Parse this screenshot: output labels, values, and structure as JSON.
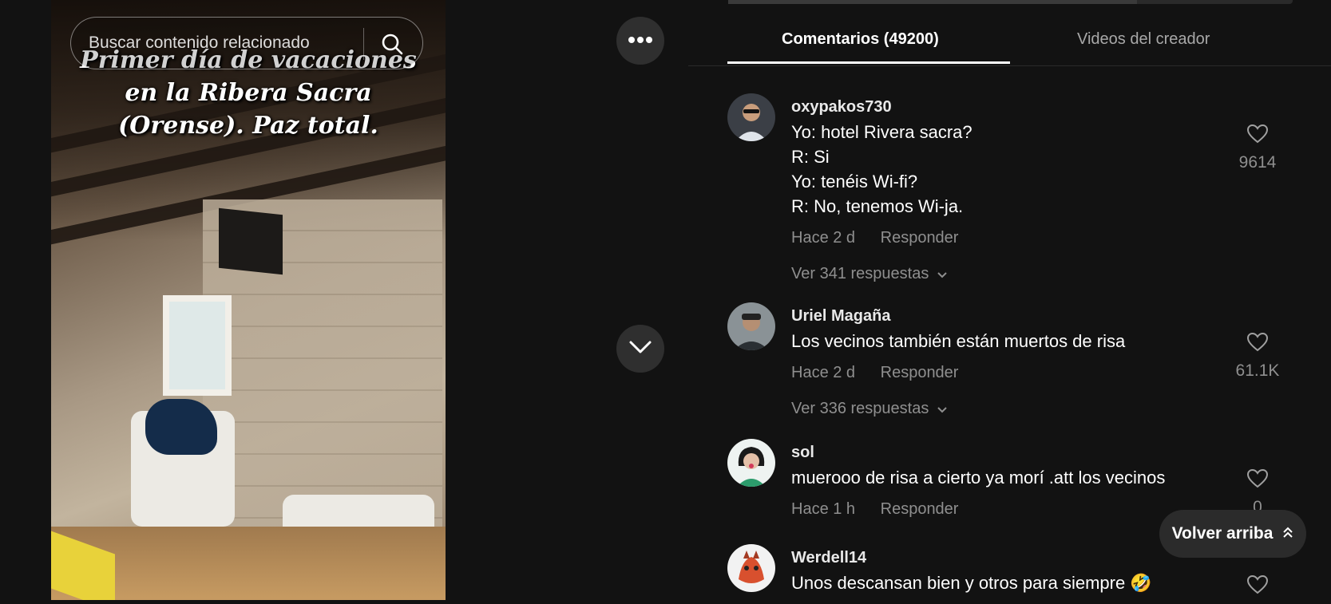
{
  "video": {
    "caption_lines": [
      "Primer día de vacaciones",
      "en la Ribera Sacra",
      "(Orense). Paz total."
    ],
    "search_placeholder": "Buscar contenido relacionado",
    "more_icon": "more-dots-icon",
    "next_icon": "chevron-down-icon"
  },
  "tabs": {
    "comments": "Comentarios (49200)",
    "creator_videos": "Videos del creador"
  },
  "comments": [
    {
      "username": "oxypakos730",
      "lines": [
        "Yo: hotel Rivera sacra?",
        "R: Si",
        "Yo: tenéis Wi-fi?",
        "R: No, tenemos Wi-ja."
      ],
      "time": "Hace 2 d",
      "reply_label": "Responder",
      "replies_label": "Ver 341 respuestas",
      "likes": "9614"
    },
    {
      "username": "Uriel Magaña",
      "lines": [
        "Los vecinos también están muertos de risa"
      ],
      "time": "Hace 2 d",
      "reply_label": "Responder",
      "replies_label": "Ver 336 respuestas",
      "likes": "61.1K"
    },
    {
      "username": "sol",
      "lines": [
        "muerooo de risa a cierto ya morí .att los vecinos"
      ],
      "time": "Hace 1 h",
      "reply_label": "Responder",
      "likes": "0"
    },
    {
      "username": "Werdell14",
      "lines": [
        "Unos descansan bien y otros para siempre 🤣"
      ]
    }
  ],
  "back_to_top": "Volver arriba",
  "colors": {
    "background": "#121212",
    "muted": "#8f8f8f",
    "button": "#2f2f2f"
  }
}
